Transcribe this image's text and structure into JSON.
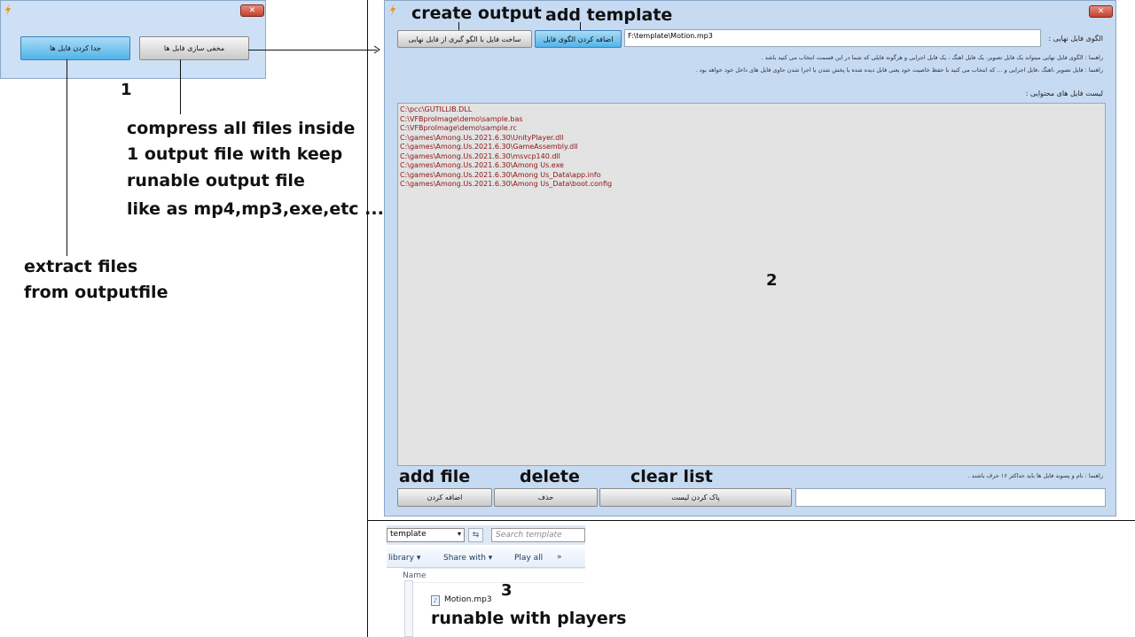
{
  "window1": {
    "close_label": "✕",
    "split_button": "جدا کردن فایل ها",
    "hide_button": "مخفی سازی فایل ها"
  },
  "annotations": {
    "num1": "1",
    "num2": "2",
    "num3": "3",
    "compress_lines": [
      "compress all files inside",
      "1 output  file with keep",
      "runable output file",
      "like as mp4,mp3,exe,etc ..."
    ],
    "extract_lines": [
      "extract files",
      "from outputfile"
    ],
    "create_output": "create output",
    "add_template": "add template",
    "add_file": "add file",
    "delete": "delete",
    "clear_list": "clear list",
    "runable": "runable with players"
  },
  "window2": {
    "close_label": "✕",
    "create_output_button": "ساخت فایل با الگو گیری از فایل نهایی",
    "add_template_button": "اضافه کردن الگوی فایل",
    "template_path": "F:\\template\\Motion.mp3",
    "template_label": "الگوی فایل نهایی :",
    "hint1": "راهنما : الگوی فایل نهایی میتواند یک فایل تصویر، یک فایل اهنگ ، یک فایل اجرایی و هرگونه فایلی که شما در این قسمت انتخاب می کنید باشد .",
    "hint2": "راهنما : فایل تصویر ،اهنگ ،فایل اجرایی و ... که انتخاب می کنید با حفظ خاصیت خود یعنی فایل دیده شده یا پخش شدن یا اجرا شدن حاوی فایل های داخل خود خواهد بود .",
    "list_label": "لیست فایل های محتوایی :",
    "files": [
      "C:\\pcc\\GUTILLIB.DLL",
      "C:\\VFBproImage\\demo\\sample.bas",
      "C:\\VFBproImage\\demo\\sample.rc",
      "C:\\games\\Among.Us.2021.6.30\\UnityPlayer.dll",
      "C:\\games\\Among.Us.2021.6.30\\GameAssembly.dll",
      "C:\\games\\Among.Us.2021.6.30\\msvcp140.dll",
      "C:\\games\\Among.Us.2021.6.30\\Among Us.exe",
      "C:\\games\\Among.Us.2021.6.30\\Among Us_Data\\app.info",
      "C:\\games\\Among.Us.2021.6.30\\Among Us_Data\\boot.config"
    ],
    "bottom_hint": "راهنما : نام و پسوند فایل ها باید حداکثر ۱۶ حرف باشند .",
    "add_button": "اضافه کردن",
    "delete_button": "حذف",
    "clear_button": "پاک کردن لیست",
    "name_value": ""
  },
  "explorer": {
    "path": "template",
    "search_placeholder": "Search template",
    "toolbar": {
      "library": "library ▾",
      "share": "Share with ▾",
      "play": "Play all",
      "more": "»"
    },
    "column": "Name",
    "file": "Motion.mp3"
  }
}
